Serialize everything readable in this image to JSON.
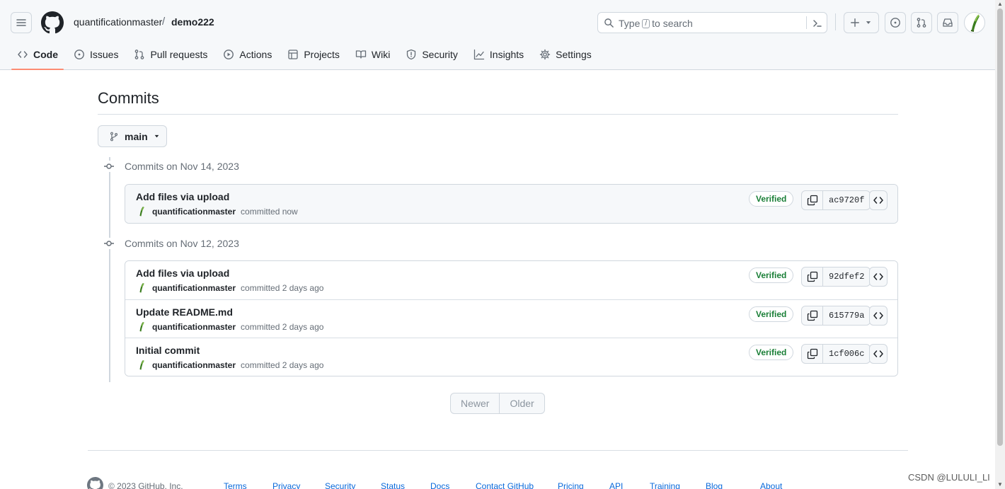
{
  "header": {
    "owner": "quantificationmaster",
    "separator": "/",
    "repo": "demo222",
    "search": {
      "prefix": "Type",
      "key": "/",
      "suffix": "to search"
    }
  },
  "tabs": [
    {
      "label": "Code",
      "icon": "code-icon",
      "active": true
    },
    {
      "label": "Issues",
      "icon": "issue-icon"
    },
    {
      "label": "Pull requests",
      "icon": "pull-request-icon"
    },
    {
      "label": "Actions",
      "icon": "play-icon"
    },
    {
      "label": "Projects",
      "icon": "table-icon"
    },
    {
      "label": "Wiki",
      "icon": "book-icon"
    },
    {
      "label": "Security",
      "icon": "shield-icon"
    },
    {
      "label": "Insights",
      "icon": "graph-icon"
    },
    {
      "label": "Settings",
      "icon": "gear-icon"
    }
  ],
  "page": {
    "title": "Commits",
    "branch": "main"
  },
  "groups": [
    {
      "heading": "Commits on Nov 14, 2023",
      "commits": [
        {
          "message": "Add files via upload",
          "author": "quantificationmaster",
          "when": "committed now",
          "badge": "Verified",
          "sha": "ac9720f"
        }
      ]
    },
    {
      "heading": "Commits on Nov 12, 2023",
      "commits": [
        {
          "message": "Add files via upload",
          "author": "quantificationmaster",
          "when": "committed 2 days ago",
          "badge": "Verified",
          "sha": "92dfef2"
        },
        {
          "message": "Update README.md",
          "author": "quantificationmaster",
          "when": "committed 2 days ago",
          "badge": "Verified",
          "sha": "615779a"
        },
        {
          "message": "Initial commit",
          "author": "quantificationmaster",
          "when": "committed 2 days ago",
          "badge": "Verified",
          "sha": "1cf006c"
        }
      ]
    }
  ],
  "pagination": {
    "newer": "Newer",
    "older": "Older"
  },
  "footer": {
    "copyright": "© 2023 GitHub, Inc.",
    "links": [
      "Terms",
      "Privacy",
      "Security",
      "Status",
      "Docs",
      "Contact GitHub",
      "Pricing",
      "API",
      "Training",
      "Blog",
      "About"
    ]
  },
  "watermark": "CSDN @LULULI_LI"
}
